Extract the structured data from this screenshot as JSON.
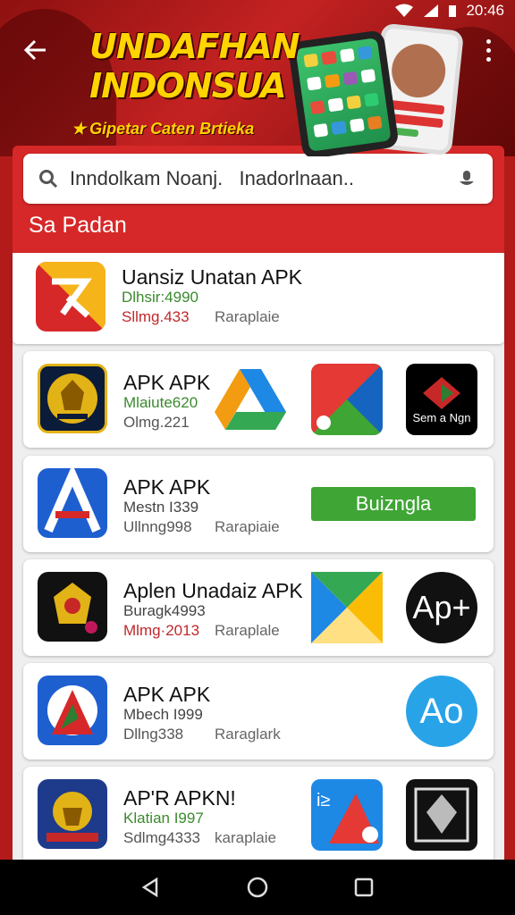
{
  "status": {
    "time": "20:46"
  },
  "header": {
    "title_line1": "UNDAFHAN",
    "title_line2": "INDONSUA",
    "subtitle": "Gipetar Caten Brtieka",
    "back_icon": "arrow-left-icon",
    "more_icon": "more-vert-icon"
  },
  "search": {
    "placeholder": "Inndolkam Noanj.   Inadorlnaan..",
    "search_icon": "search-icon",
    "mic_icon": "mic-icon"
  },
  "section": {
    "title": "Sa Padan"
  },
  "apps": [
    {
      "name": "Uansiz Unatan APK",
      "meta1": "Dlhsir:4990",
      "meta2": "Sllmg.433",
      "tag": "Raraplaie"
    },
    {
      "name": "APK APK",
      "meta1": "Mlaiute620",
      "meta2": "Olmg.221",
      "thumb_text": "Sem a Ngn"
    },
    {
      "name": "APK APK",
      "meta1": "Mestn I339",
      "meta2": "Ullnng998",
      "tag": "Rarapiaie",
      "button": "Buizngla"
    },
    {
      "name": "Aplen Unadaiz APK",
      "meta1": "Buragk4993",
      "meta2": "Mlmg·2013",
      "tag": "Raraplale",
      "thumb_text": "Ap+"
    },
    {
      "name": "APK APK",
      "meta1": "Mbech I999",
      "meta2": "Dllng338",
      "tag": "Raraglark",
      "thumb_text": "Ao"
    },
    {
      "name": "AP'R APKN!",
      "meta1": "Klatian I997",
      "meta2": "Sdlmg4333",
      "tag": "karaplaie",
      "thumb_text": "i≥"
    }
  ],
  "nav": {
    "back": "nav-back-icon",
    "home": "nav-home-icon",
    "recents": "nav-recents-icon"
  }
}
